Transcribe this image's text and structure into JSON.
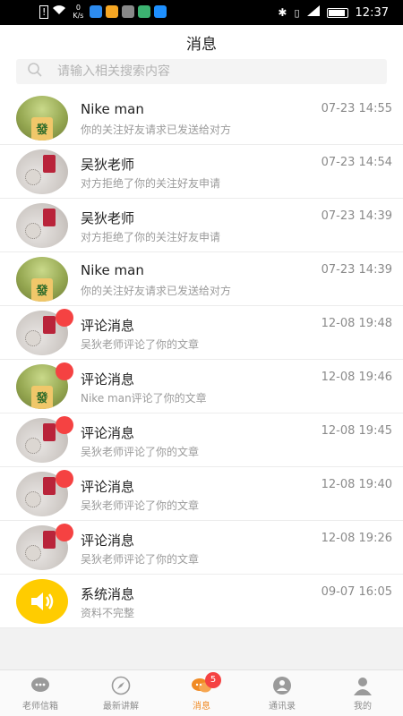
{
  "status_bar": {
    "time": "12:37",
    "net_speed": "0",
    "net_unit": "K/s"
  },
  "header": {
    "title": "消息"
  },
  "search": {
    "placeholder": "请输入相关搜索内容"
  },
  "messages": [
    {
      "name": "Nike man",
      "preview": "你的关注好友请求已发送给对方",
      "time": "07-23 14:55",
      "avatar": "green-tile-avatar",
      "unread": false
    },
    {
      "name": "吴狄老师",
      "preview": "对方拒绝了你的关注好友申请",
      "time": "07-23 14:54",
      "avatar": "desk-photo-avatar",
      "unread": false
    },
    {
      "name": "吴狄老师",
      "preview": "对方拒绝了你的关注好友申请",
      "time": "07-23 14:39",
      "avatar": "desk-photo-avatar",
      "unread": false
    },
    {
      "name": "Nike man",
      "preview": "你的关注好友请求已发送给对方",
      "time": "07-23 14:39",
      "avatar": "green-tile-avatar",
      "unread": false
    },
    {
      "name": "评论消息",
      "preview": "吴狄老师评论了你的文章",
      "time": "12-08 19:48",
      "avatar": "desk-photo-avatar",
      "unread": true
    },
    {
      "name": "评论消息",
      "preview": "Nike man评论了你的文章",
      "time": "12-08 19:46",
      "avatar": "green-tile-avatar",
      "unread": true
    },
    {
      "name": "评论消息",
      "preview": "吴狄老师评论了你的文章",
      "time": "12-08 19:45",
      "avatar": "desk-photo-avatar",
      "unread": true
    },
    {
      "name": "评论消息",
      "preview": "吴狄老师评论了你的文章",
      "time": "12-08 19:40",
      "avatar": "desk-photo-avatar",
      "unread": true
    },
    {
      "name": "评论消息",
      "preview": "吴狄老师评论了你的文章",
      "time": "12-08 19:26",
      "avatar": "desk-photo-avatar",
      "unread": true
    },
    {
      "name": "系统消息",
      "preview": "资料不完整",
      "time": "09-07 16:05",
      "avatar": "speaker-icon",
      "unread": false
    }
  ],
  "avatar_glyph": "發",
  "tabs": [
    {
      "label": "老师信箱",
      "icon": "chat-bubble-icon"
    },
    {
      "label": "最新讲解",
      "icon": "compass-icon"
    },
    {
      "label": "消息",
      "icon": "message-icon",
      "badge": "5",
      "active": true
    },
    {
      "label": "通讯录",
      "icon": "contacts-icon"
    },
    {
      "label": "我的",
      "icon": "person-icon"
    }
  ],
  "colors": {
    "accent": "#f08a24",
    "badge": "#f54242",
    "speaker_bg": "#ffcc00"
  }
}
